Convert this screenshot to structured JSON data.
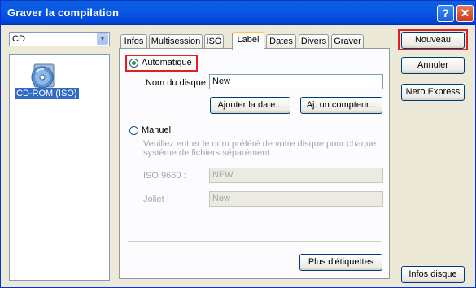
{
  "window": {
    "title": "Graver la compilation",
    "help_glyph": "?",
    "close_glyph": "✕"
  },
  "media_combo": {
    "value": "CD",
    "arrow_glyph": "▼"
  },
  "compilation_list": {
    "items": [
      {
        "label": "CD-ROM (ISO)",
        "icon": "cd-rom-iso-icon"
      }
    ]
  },
  "tabs": [
    {
      "label": "Infos"
    },
    {
      "label": "Multisession"
    },
    {
      "label": "ISO"
    },
    {
      "label": "Label",
      "active": true
    },
    {
      "label": "Dates"
    },
    {
      "label": "Divers"
    },
    {
      "label": "Graver"
    }
  ],
  "label_tab": {
    "auto": {
      "label": "Automatique",
      "selected": true,
      "disc_name_label": "Nom du disque :",
      "disc_name_value": "New",
      "add_date_button": "Ajouter la date...",
      "add_counter_button": "Aj. un compteur..."
    },
    "manual": {
      "label": "Manuel",
      "selected": false,
      "hint": "Veuillez entrer le nom préféré de votre disque pour chaque système de fichiers séparément.",
      "iso_label": "ISO 9660 :",
      "iso_value": "NEW",
      "joliet_label": "Joliet :",
      "joliet_value": "New"
    },
    "more_labels_button": "Plus d'étiquettes"
  },
  "side_buttons": {
    "new": "Nouveau",
    "cancel": "Annuler",
    "nero_express": "Nero Express",
    "disc_info": "Infos disque"
  },
  "colors": {
    "title_bar": "#0a5fd8",
    "highlight": "#e02020",
    "dialog_bg": "#ece9d8",
    "selection": "#316ac5"
  }
}
